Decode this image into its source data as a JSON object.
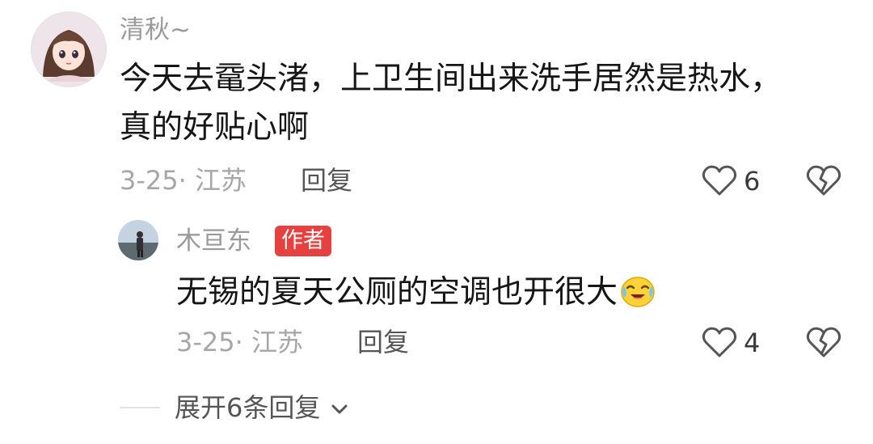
{
  "comment": {
    "username": "清秋~",
    "text_line1": "今天去鼋头渚，上卫生间出来洗手居然是热水，",
    "text_line2": "真的好贴心啊",
    "date_location": "3-25· 江苏",
    "reply_label": "回复",
    "like_count": "6",
    "avatar_icon": "anime-girl-avatar",
    "like_icon": "heart-outline-icon",
    "dislike_icon": "broken-heart-icon"
  },
  "reply": {
    "username": "木亘东",
    "author_badge": "作者",
    "text": "无锡的夏天公厕的空调也开很大",
    "emoji_icon": "crying-laughing-emoji",
    "date_location": "3-25· 江苏",
    "reply_label": "回复",
    "like_count": "4",
    "avatar_icon": "person-avatar"
  },
  "expand": {
    "label": "展开6条回复"
  },
  "colors": {
    "badge": "#e6413e",
    "muted": "#a6a6a6",
    "text": "#161616"
  }
}
